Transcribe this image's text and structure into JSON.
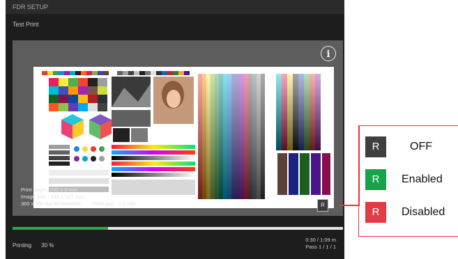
{
  "window": {
    "title": "FDR SETUP"
  },
  "screen": {
    "subtitle": "Test Print"
  },
  "preview": {
    "info_icon": "info-icon",
    "lines": [
      "Print origin : 345 x 0 mm",
      "Image size : 335 x 167 mm",
      "360 x 360 dpi Bi-Direction"
    ],
    "feed_gap": "Feed gap : 1.5 mm",
    "r_button_label": "R"
  },
  "progress": {
    "fraction": 0.29,
    "color": "#2ca84c"
  },
  "status": {
    "label": "Printing",
    "percent": "30 %",
    "time": "0:30 / 1:09 m",
    "pass": "Pass 1 / 1 / 1"
  },
  "legend": {
    "items": [
      {
        "letter": "R",
        "label": "OFF",
        "color": "#3f3f3f"
      },
      {
        "letter": "R",
        "label": "Enabled",
        "color": "#16a34a"
      },
      {
        "letter": "R",
        "label": "Disabled",
        "color": "#e23b45"
      }
    ],
    "frame_color": "#e8323b"
  }
}
